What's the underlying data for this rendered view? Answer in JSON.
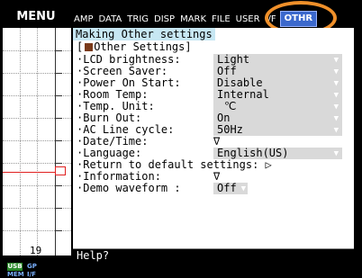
{
  "menu_label": "MENU",
  "tabs": [
    "AMP",
    "DATA",
    "TRIG",
    "DISP",
    "MARK",
    "FILE",
    "USER",
    "I/F",
    "OTHR"
  ],
  "active_tab": "OTHR",
  "panel_title": "Making Other settings",
  "section_header": "Other Settings",
  "settings": [
    {
      "label": "LCD brightness:",
      "value": "Light"
    },
    {
      "label": "Screen Saver:",
      "value": "Off"
    },
    {
      "label": "Power On Start:",
      "value": "Disable"
    },
    {
      "label": "Room Temp:",
      "value": "Internal"
    },
    {
      "label": "Temp. Unit:",
      "value": "℃"
    },
    {
      "label": "Burn Out:",
      "value": "On"
    },
    {
      "label": "AC Line cycle:",
      "value": "50Hz"
    },
    {
      "label": "Date/Time:",
      "value": "∇"
    },
    {
      "label": "Language:",
      "value": "English(US)"
    },
    {
      "label": "Return to default settings:",
      "value": "▷"
    },
    {
      "label": "Information:",
      "value": "∇"
    },
    {
      "label": "Demo waveform :",
      "value": "Off"
    }
  ],
  "help_text": "Help?",
  "waveform_scale_number": "19",
  "status": {
    "usb": "USB",
    "mem": "MEM",
    "ch_top": "GP",
    "ch_bottom": "I/F"
  },
  "colors": {
    "active_tab": "#3b68cc",
    "title_bg": "#c7e7f3",
    "ring": "#f0902a",
    "trace": "#e02020",
    "usb_badge": "#2a8a2a"
  }
}
